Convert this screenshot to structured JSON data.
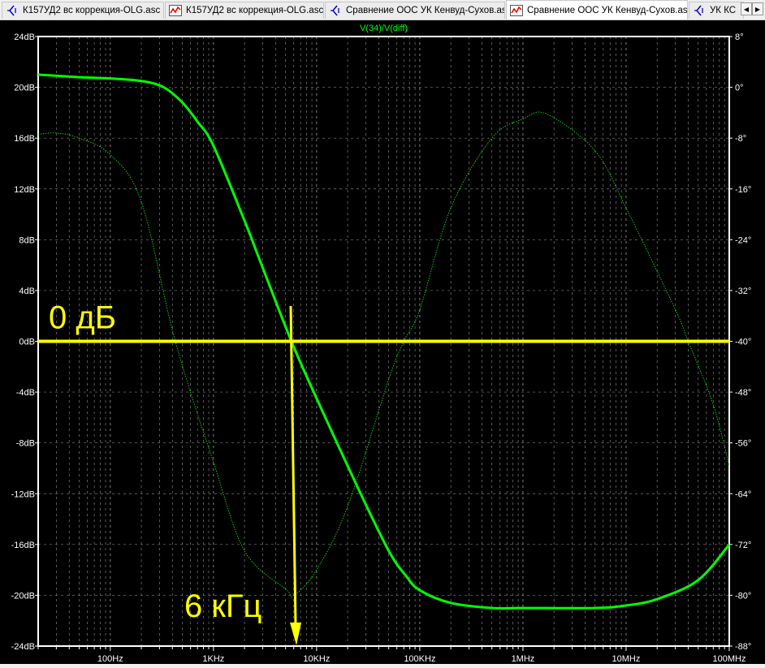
{
  "tabs": [
    {
      "label": "К157УД2 вс коррекция-OLG.asc",
      "icon": "schematic-icon",
      "active": false
    },
    {
      "label": "К157УД2 вс коррекция-OLG.asc",
      "icon": "waveform-icon",
      "active": false
    },
    {
      "label": "Сравнение ООС УК Кенвуд-Сухов.asc",
      "icon": "schematic-icon",
      "active": false
    },
    {
      "label": "Сравнение ООС УК Кенвуд-Сухов.asc",
      "icon": "waveform-icon",
      "active": true
    },
    {
      "label": "УК КС",
      "icon": "schematic-icon",
      "active": false
    }
  ],
  "scroll_left": "◀",
  "scroll_right": "▶",
  "colors": {
    "trace": "#00ff00",
    "annotation": "#ffff00",
    "grid": "#808080",
    "frame": "#ffffff"
  },
  "chart_data": {
    "type": "line",
    "title": "V(34)/V(diff)",
    "xscale": "log",
    "xlim": [
      20,
      100000000
    ],
    "x_ticks": [
      {
        "value": 100,
        "label": "100Hz"
      },
      {
        "value": 1000,
        "label": "1KHz"
      },
      {
        "value": 10000,
        "label": "10KHz"
      },
      {
        "value": 100000,
        "label": "100KHz"
      },
      {
        "value": 1000000,
        "label": "1MHz"
      },
      {
        "value": 10000000,
        "label": "10MHz"
      },
      {
        "value": 100000000,
        "label": "100MHz"
      }
    ],
    "ylim": [
      -24,
      24
    ],
    "y_ticks": [
      "24dB",
      "20dB",
      "16dB",
      "12dB",
      "8dB",
      "4dB",
      "0dB",
      "-4dB",
      "-8dB",
      "-12dB",
      "-16dB",
      "-20dB",
      "-24dB"
    ],
    "y2lim": [
      -88,
      8
    ],
    "y2_ticks": [
      "8°",
      "0°",
      "-8°",
      "-16°",
      "-24°",
      "-32°",
      "-40°",
      "-48°",
      "-56°",
      "-64°",
      "-72°",
      "-80°",
      "-88°"
    ],
    "grid": true,
    "series": [
      {
        "name": "magnitude",
        "axis": "left",
        "style": "solid",
        "x": [
          20,
          50,
          100,
          200,
          330,
          500,
          700,
          1000,
          2000,
          3000,
          5700,
          10000,
          25000,
          50000,
          74000,
          100000,
          200000,
          500000,
          1000000,
          5000000,
          10000000,
          20000000,
          50000000,
          100000000
        ],
        "y": [
          21,
          20.8,
          20.7,
          20.5,
          20,
          18.8,
          17.3,
          15.4,
          9.5,
          5.8,
          0,
          -4.5,
          -11.5,
          -16.5,
          -18.5,
          -19.6,
          -20.6,
          -21,
          -21,
          -21,
          -20.8,
          -20.3,
          -18.8,
          -16
        ]
      },
      {
        "name": "phase",
        "axis": "right",
        "style": "dotted",
        "x": [
          20,
          30,
          50,
          100,
          200,
          427,
          1000,
          2000,
          5000,
          6000,
          10000,
          20000,
          50000,
          70000,
          100000,
          200000,
          500000,
          1000000,
          1700000,
          5000000,
          10000000,
          30000000,
          40000000,
          70000000,
          100000000
        ],
        "y": [
          -7.4,
          -7.2,
          -8,
          -10.6,
          -18,
          -40,
          -59,
          -73,
          -79,
          -80,
          -76,
          -66,
          -46,
          -40,
          -35,
          -19,
          -8,
          -5,
          -4.2,
          -10,
          -19,
          -35,
          -40,
          -50,
          -59.6
        ]
      }
    ],
    "annotations": [
      {
        "text": "0 дБ",
        "type": "hline",
        "y": 0
      },
      {
        "text": "6 кГц",
        "type": "arrow",
        "x": 6000
      }
    ]
  }
}
